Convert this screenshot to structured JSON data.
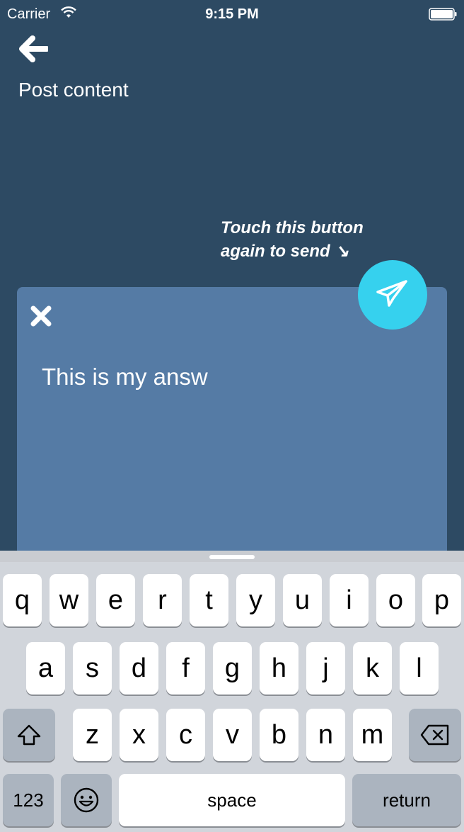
{
  "status_bar": {
    "carrier": "Carrier",
    "time": "9:15 PM"
  },
  "header": {
    "title": "Post content"
  },
  "hint": {
    "line1": "Touch this button",
    "line2": "again to send ↘"
  },
  "editor": {
    "text": "This is my answ"
  },
  "colors": {
    "background": "#2d4a63",
    "card": "#557ba5",
    "send_button": "#36d1ee"
  },
  "icons": {
    "back": "arrow-left-icon",
    "close": "close-icon",
    "send": "paper-plane-icon",
    "shift": "shift-icon",
    "delete": "backspace-icon",
    "emoji": "emoji-icon"
  },
  "keyboard": {
    "row1": [
      "q",
      "w",
      "e",
      "r",
      "t",
      "y",
      "u",
      "i",
      "o",
      "p"
    ],
    "row2": [
      "a",
      "s",
      "d",
      "f",
      "g",
      "h",
      "j",
      "k",
      "l"
    ],
    "row3": [
      "z",
      "x",
      "c",
      "v",
      "b",
      "n",
      "m"
    ],
    "numbers": "123",
    "space": "space",
    "return": "return"
  }
}
